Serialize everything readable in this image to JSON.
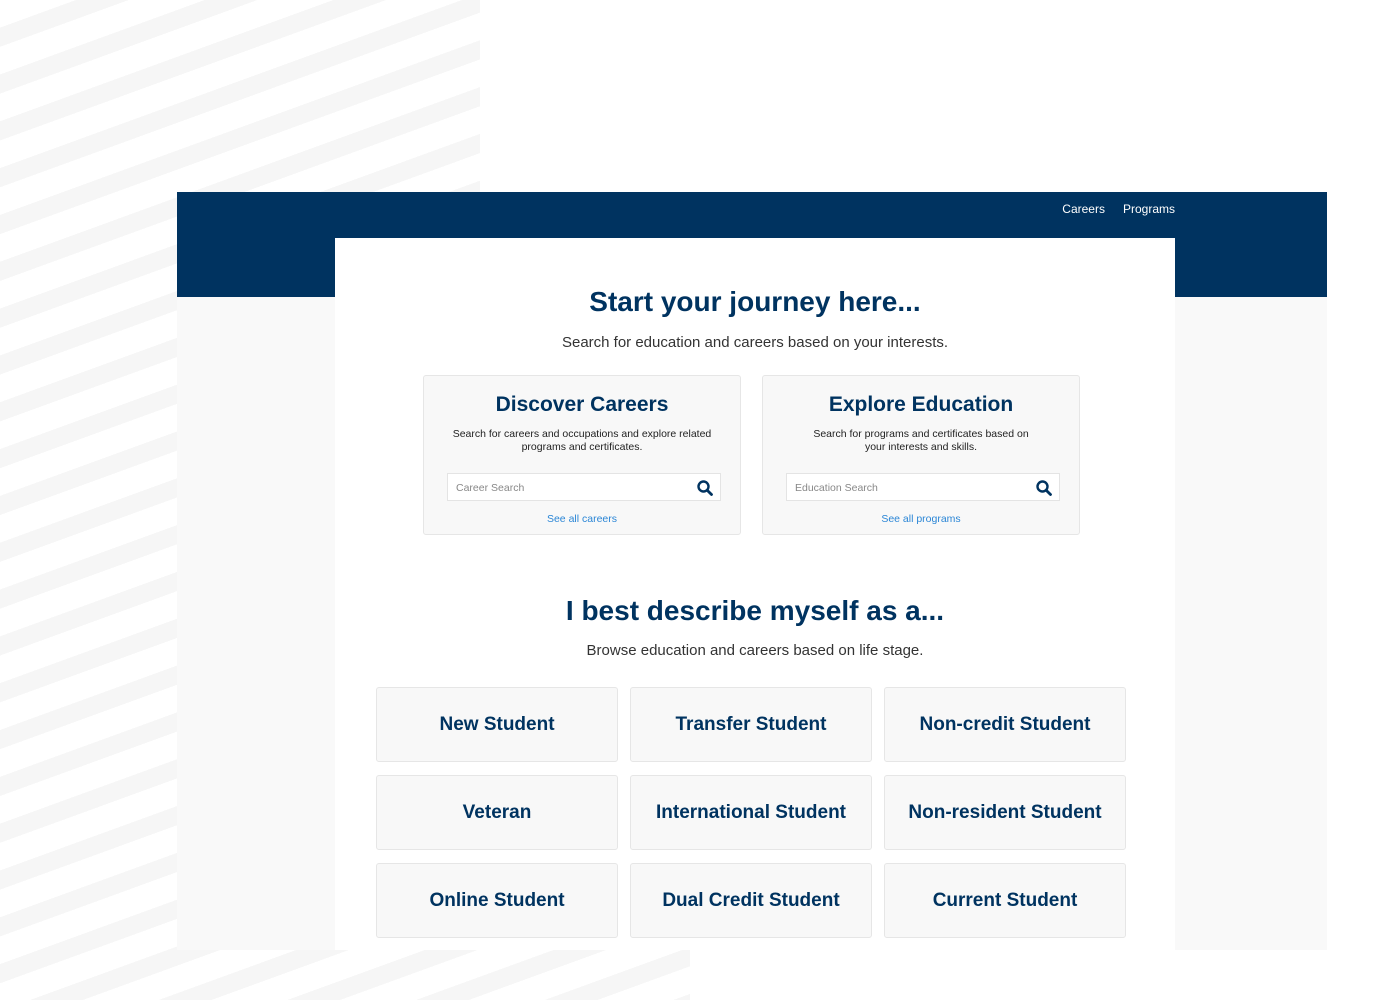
{
  "nav": {
    "items": [
      {
        "label": "Careers"
      },
      {
        "label": "Programs"
      }
    ]
  },
  "hero": {
    "title": "Start your journey here...",
    "subtitle": "Search for education and careers based on your interests."
  },
  "cards": [
    {
      "title": "Discover Careers",
      "description": "Search for careers and occupations and explore related programs and certificates.",
      "search_placeholder": "Career Search",
      "search_value": "",
      "search_icon": "search-icon",
      "link": "See all careers"
    },
    {
      "title": "Explore Education",
      "description": "Search for programs and certificates based on your interests and skills.",
      "search_placeholder": "Education Search",
      "search_value": "",
      "search_icon": "search-icon",
      "link": "See all programs"
    }
  ],
  "lifestage": {
    "title": "I best describe myself as a...",
    "subtitle": "Browse education and careers based on life stage.",
    "options": [
      "New Student",
      "Transfer Student",
      "Non-credit Student",
      "Veteran",
      "International Student",
      "Non-resident Student",
      "Online Student",
      "Dual Credit Student",
      "Current Student"
    ]
  },
  "colors": {
    "brand_navy": "#003360",
    "link_blue": "#2b86d6",
    "tile_bg": "#f8f8f8"
  }
}
